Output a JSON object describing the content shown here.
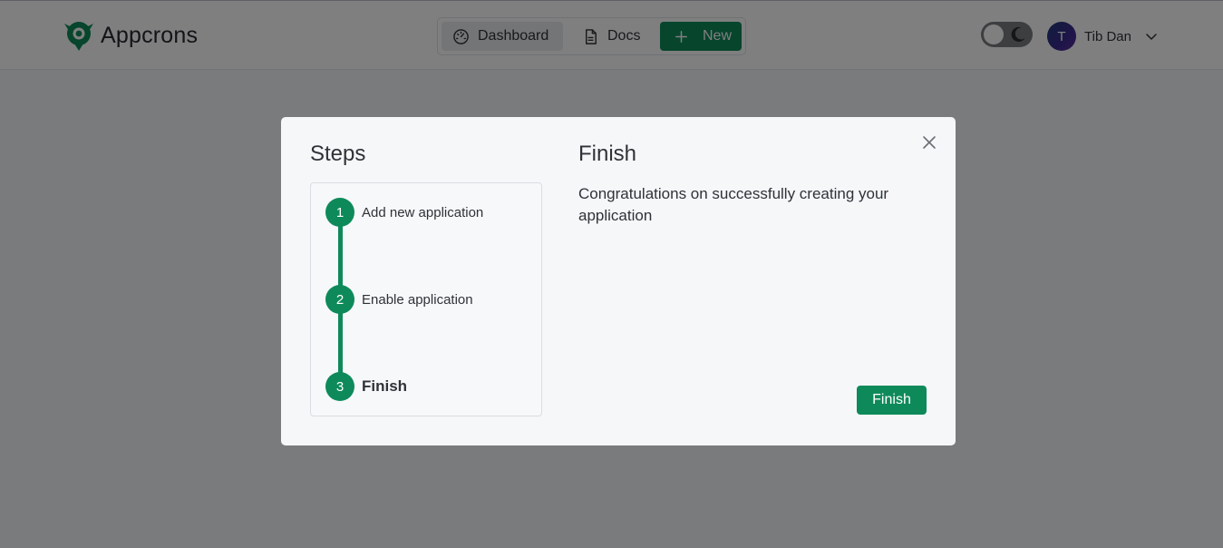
{
  "app": {
    "name": "Appcrons"
  },
  "nav": {
    "dashboard_label": "Dashboard",
    "docs_label": "Docs",
    "new_label": "New"
  },
  "theme_toggle": {
    "state": "light",
    "icons": [
      "sun-knob",
      "moon-icon"
    ]
  },
  "user": {
    "initial": "T",
    "name": "Tib Dan"
  },
  "modal": {
    "steps_title": "Steps",
    "steps": [
      {
        "number": "1",
        "label": "Add new application",
        "active": false
      },
      {
        "number": "2",
        "label": "Enable application",
        "active": false
      },
      {
        "number": "3",
        "label": "Finish",
        "active": true
      }
    ],
    "content_title": "Finish",
    "content_text": "Congratulations on successfully creating your application",
    "finish_button": "Finish"
  },
  "colors": {
    "accent": "#0e8a5a",
    "overlay": "rgba(0,0,0,0.5)",
    "modal_bg": "#f5f7f9"
  }
}
